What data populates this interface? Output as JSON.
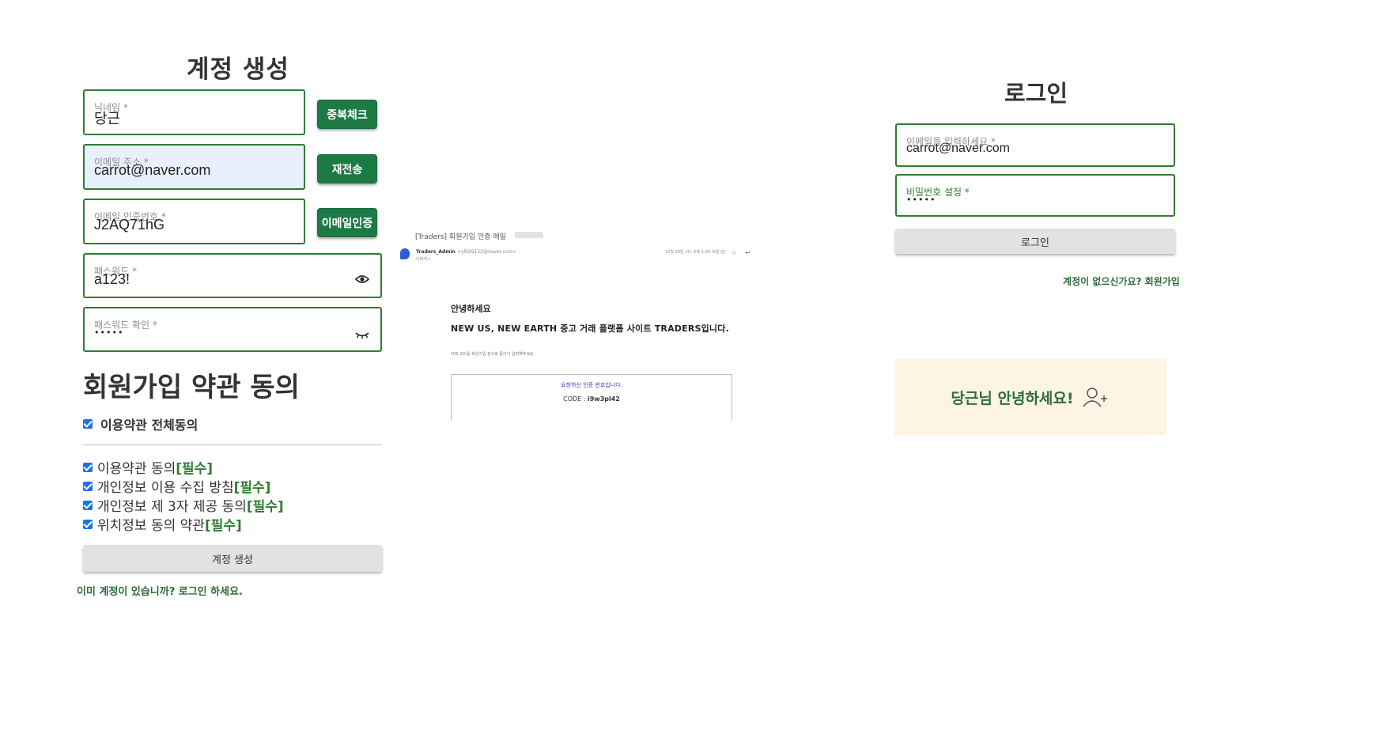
{
  "signup": {
    "title": "계정 생성",
    "nickname": {
      "label": "닉네임 *",
      "value": "당근",
      "button": "중복체크"
    },
    "email": {
      "label": "이메일 주소 *",
      "value": "carrot@naver.com",
      "button": "재전송"
    },
    "verify": {
      "label": "이메일 인증번호 *",
      "value": "J2AQ71hG",
      "button": "이메일인증"
    },
    "password": {
      "label": "패스워드 *",
      "value": "a123!"
    },
    "password_confirm": {
      "label": "패스워드 확인 *",
      "value": "•••••"
    },
    "terms_title": "회원가입 약관 동의",
    "agree_all": "이용약관 전체동의",
    "terms": [
      {
        "text": "이용약관 동의",
        "required": "[필수]"
      },
      {
        "text": "개인정보 이용 수집 방침",
        "required": "[필수]"
      },
      {
        "text": "개인정보 제 3자 제공 동의",
        "required": "[필수]"
      },
      {
        "text": "위치정보 동의 약관",
        "required": "[필수]"
      }
    ],
    "submit": "계정 생성",
    "login_link": "이미 계정이 있습니까? 로그인 하세요."
  },
  "email_card": {
    "subject": "[Traders] 회원가입 인증 메일",
    "sender_name": "Traders_Admin",
    "sender_addr": "<ylh99122@naver.com>",
    "to": "나에게 ▾",
    "date": "12월 28일 (수) 오후 1:50 (6일 전)",
    "greeting": "안녕하세요",
    "headline": "NEW US, NEW EARTH 중고 거래 플랫폼 사이트 TRADERS입니다.",
    "instruction": "아래 코드를 회원가입 창으로 돌아가 입력해주세요",
    "code_notice": "요청하신 인증 번호입니다.",
    "code_label": "CODE : ",
    "code_value": "i9w3pl42"
  },
  "login": {
    "title": "로그인",
    "email": {
      "label": "이메일을 입력하세요 *",
      "value": "carrot@naver.com"
    },
    "password": {
      "label": "비밀번호 설정 *",
      "value": "•••••"
    },
    "submit": "로그인",
    "signup_link": "계정이 없으신가요? 회원가입",
    "welcome": "당근님 안녕하세요!"
  },
  "colors": {
    "primary_green": "#1e7a45",
    "welcome_bg": "#fdf4e4",
    "checkbox": "#1a73e8"
  }
}
